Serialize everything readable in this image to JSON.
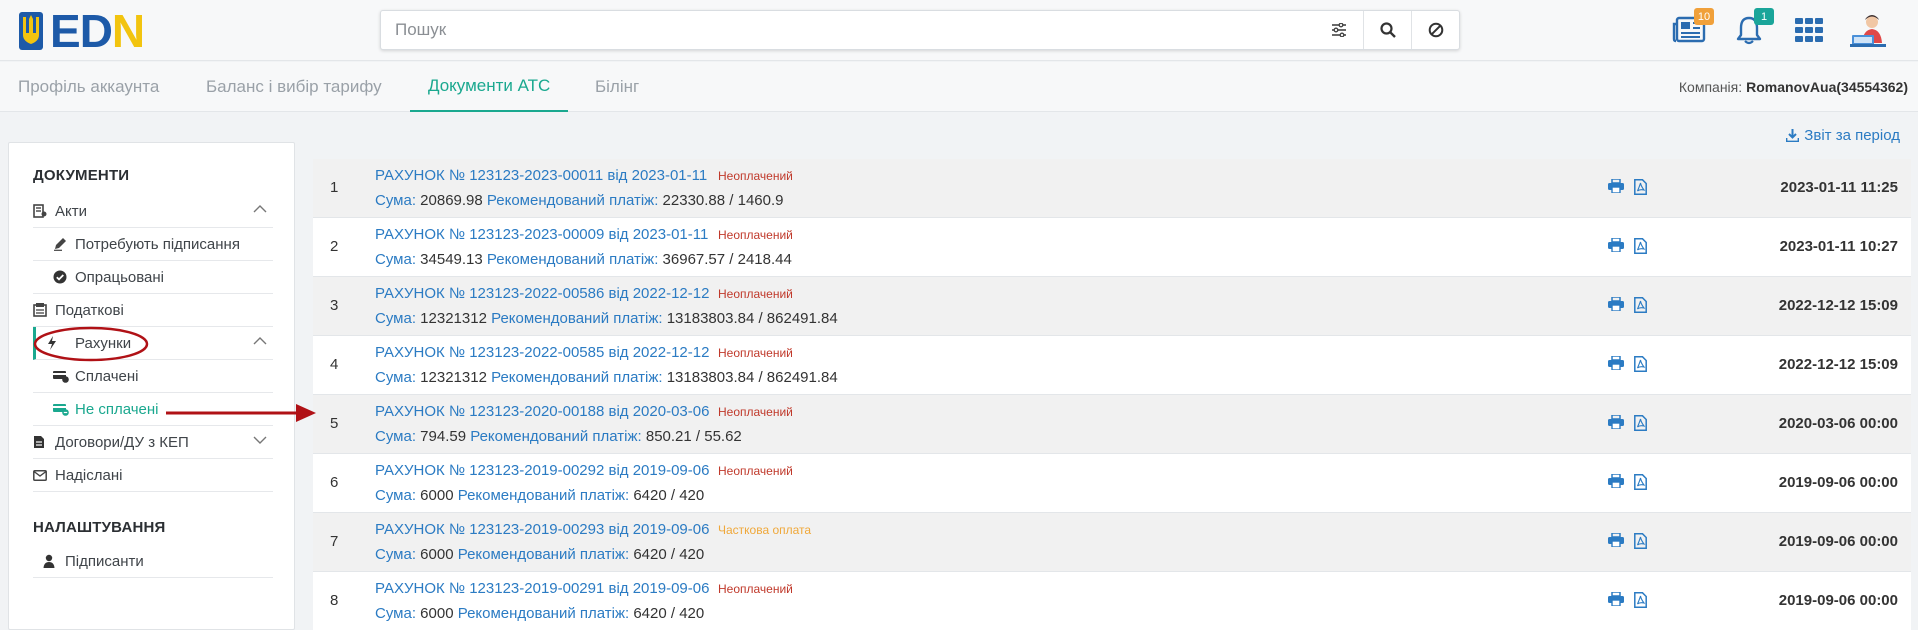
{
  "header": {
    "logo_text_e": "E",
    "logo_text_d": "D",
    "logo_text_n": "N",
    "search_placeholder": "Пошук",
    "badges": {
      "news": "10",
      "notifications": "1"
    }
  },
  "tabs": [
    {
      "label": "Профіль аккаунта"
    },
    {
      "label": "Баланс і вибір тарифу"
    },
    {
      "label": "Документи АТС"
    },
    {
      "label": "Білінг"
    }
  ],
  "company": {
    "label": "Компанія:",
    "value": "RomanovAua(34554362)"
  },
  "report_link": "Звіт за період",
  "sidebar": {
    "documents_title": "ДОКУМЕНТИ",
    "acts": "Акти",
    "need_signing": "Потребують підписання",
    "processed": "Опрацьовані",
    "tax": "Податкові",
    "invoices": "Рахунки",
    "paid": "Сплачені",
    "unpaid": "Не сплачені",
    "contracts": "Договори/ДУ з КЕП",
    "sent": "Надіслані",
    "settings_title": "НАЛАШТУВАННЯ",
    "signers": "Підписанти"
  },
  "labels": {
    "sum": "Сума:",
    "recommended": "Рекомендований платіж:"
  },
  "colors": {
    "accent": "#1aa88f",
    "link": "#2b7bc3",
    "unpaid": "#c0392b",
    "partial": "#f0a83a",
    "annotation": "#b01116"
  },
  "rows": [
    {
      "num": "1",
      "title": "РАХУНОК № 123123-2023-00011 від 2023-01-11",
      "status": "Неоплачений",
      "status_type": "red",
      "sum": "20869.98",
      "recommended": "22330.88 / 1460.9",
      "date": "2023-01-11 11:25"
    },
    {
      "num": "2",
      "title": "РАХУНОК № 123123-2023-00009 від 2023-01-11",
      "status": "Неоплачений",
      "status_type": "red",
      "sum": "34549.13",
      "recommended": "36967.57 / 2418.44",
      "date": "2023-01-11 10:27"
    },
    {
      "num": "3",
      "title": "РАХУНОК № 123123-2022-00586 від 2022-12-12",
      "status": "Неоплачений",
      "status_type": "red",
      "sum": "12321312",
      "recommended": "13183803.84 / 862491.84",
      "date": "2022-12-12 15:09"
    },
    {
      "num": "4",
      "title": "РАХУНОК № 123123-2022-00585 від 2022-12-12",
      "status": "Неоплачений",
      "status_type": "red",
      "sum": "12321312",
      "recommended": "13183803.84 / 862491.84",
      "date": "2022-12-12 15:09"
    },
    {
      "num": "5",
      "title": "РАХУНОК № 123123-2020-00188 від 2020-03-06",
      "status": "Неоплачений",
      "status_type": "red",
      "sum": "794.59",
      "recommended": "850.21 / 55.62",
      "date": "2020-03-06 00:00"
    },
    {
      "num": "6",
      "title": "РАХУНОК № 123123-2019-00292 від 2019-09-06",
      "status": "Неоплачений",
      "status_type": "red",
      "sum": "6000",
      "recommended": "6420 / 420",
      "date": "2019-09-06 00:00"
    },
    {
      "num": "7",
      "title": "РАХУНОК № 123123-2019-00293 від 2019-09-06",
      "status": "Часткова оплата",
      "status_type": "orange",
      "sum": "6000",
      "recommended": "6420 / 420",
      "date": "2019-09-06 00:00"
    },
    {
      "num": "8",
      "title": "РАХУНОК № 123123-2019-00291 від 2019-09-06",
      "status": "Неоплачений",
      "status_type": "red",
      "sum": "6000",
      "recommended": "6420 / 420",
      "date": "2019-09-06 00:00"
    }
  ]
}
